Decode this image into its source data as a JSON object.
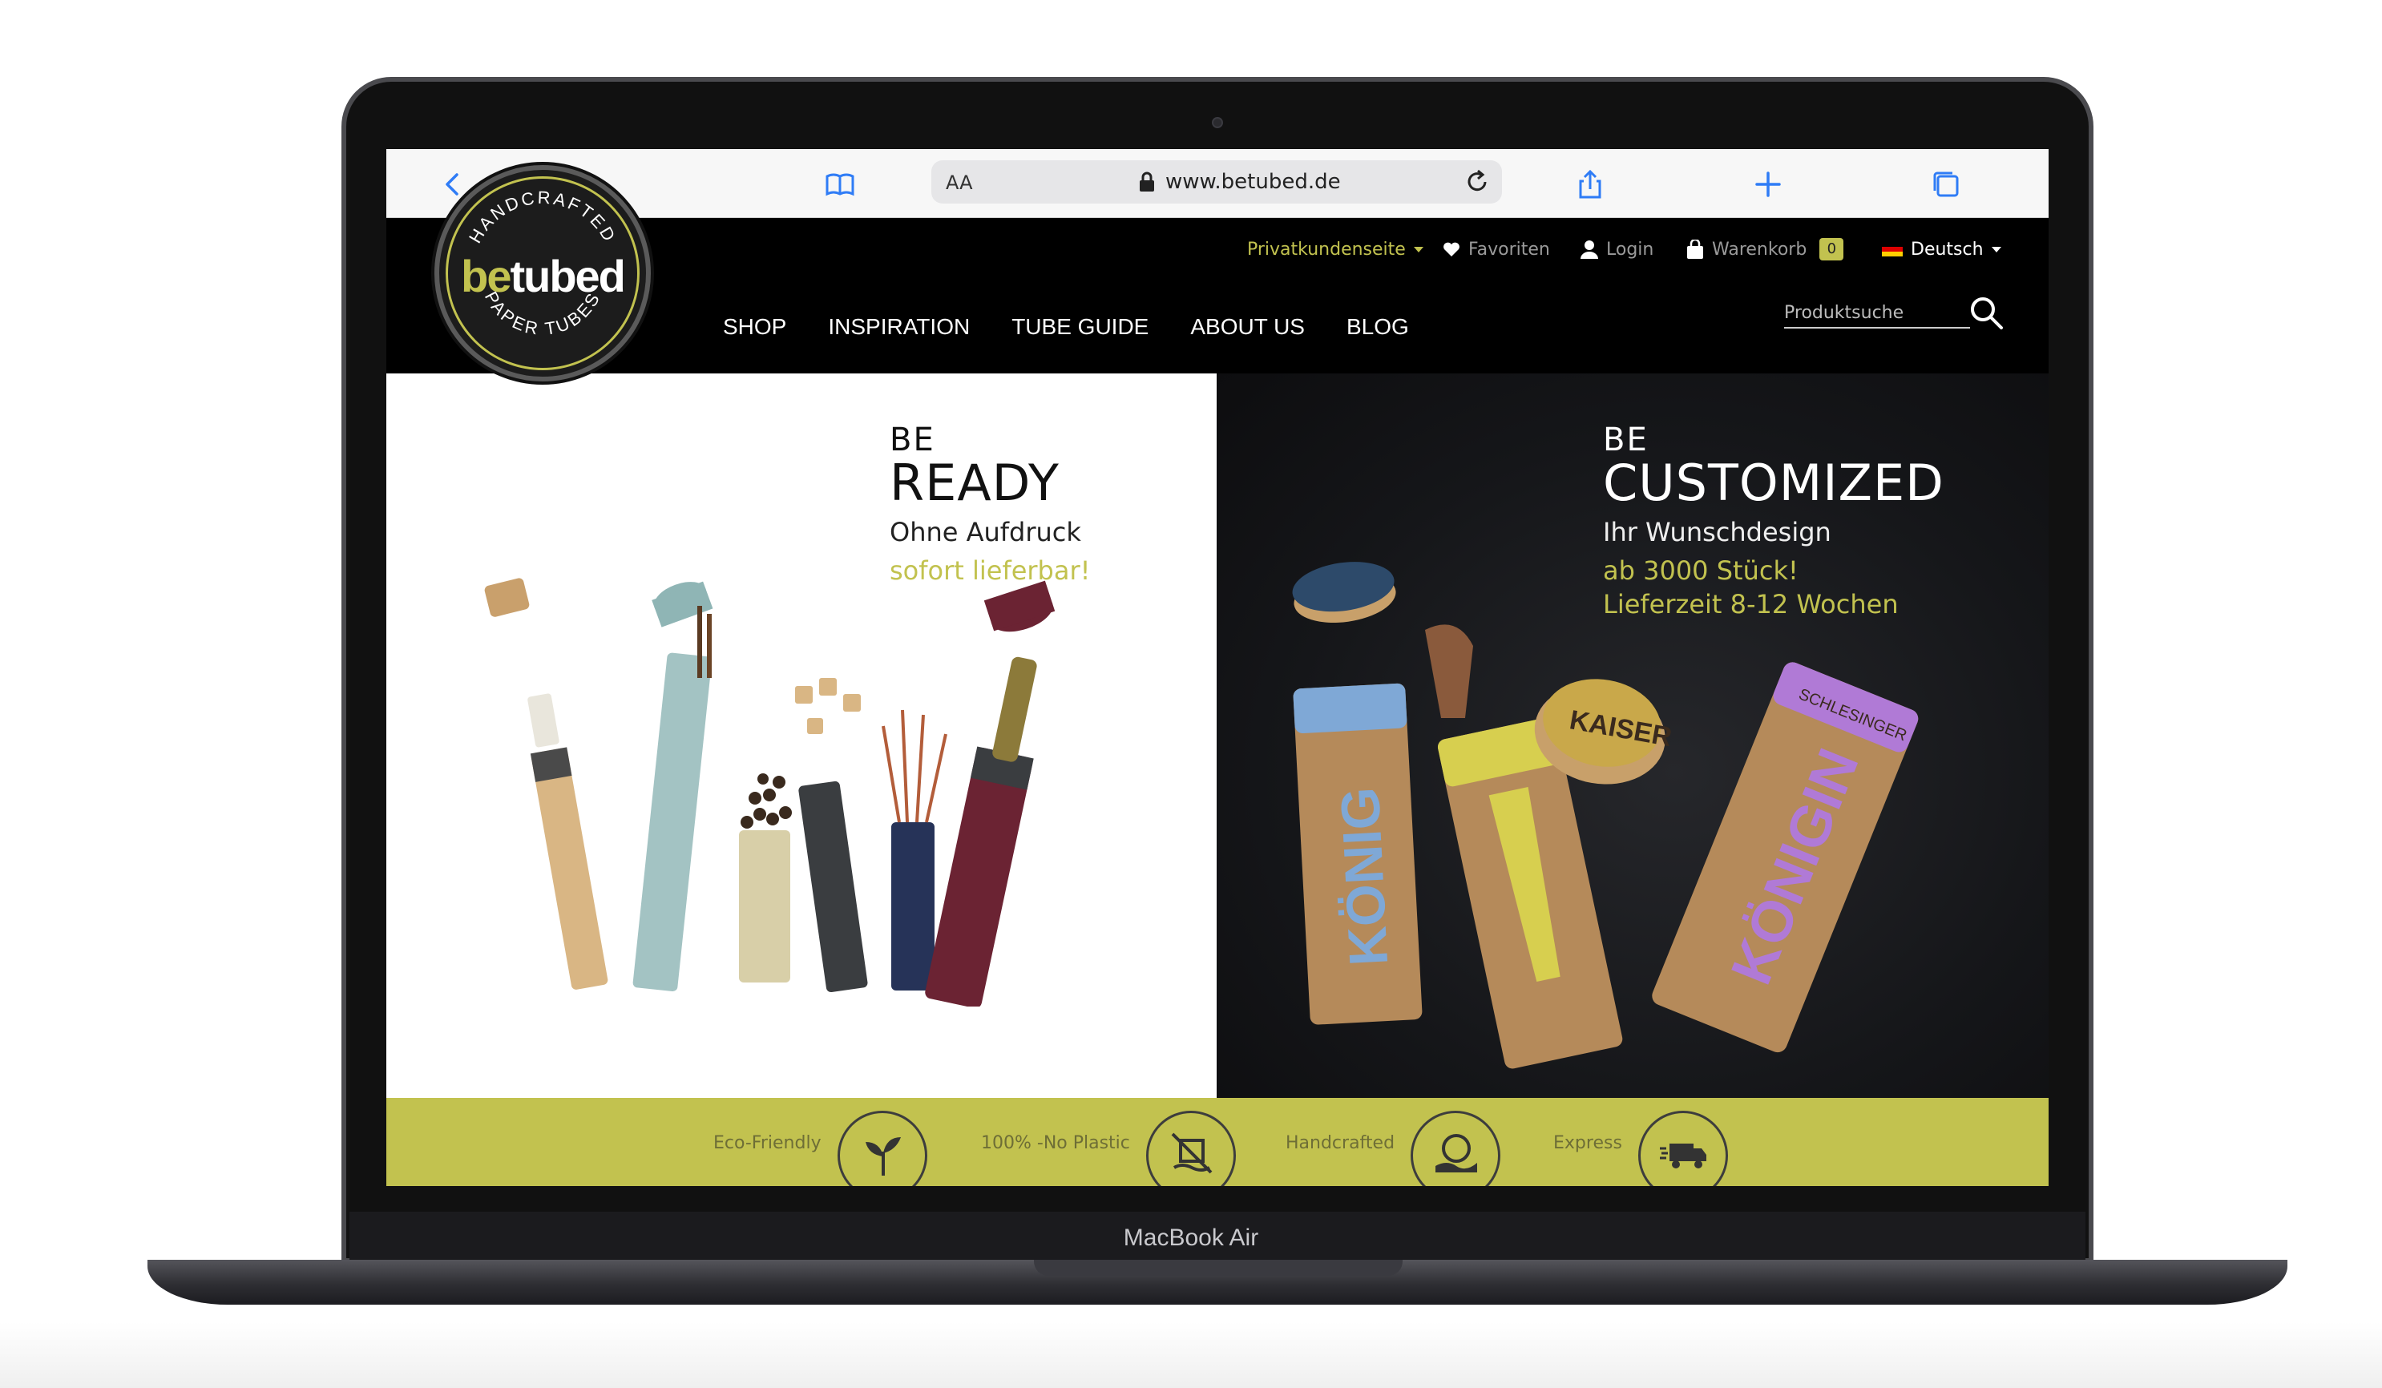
{
  "device": {
    "label": "MacBook Air"
  },
  "browser": {
    "text_size_label": "AA",
    "url": "www.betubed.de"
  },
  "util_bar": {
    "customer_page": "Privatkundenseite",
    "favorites": "Favoriten",
    "login": "Login",
    "cart": "Warenkorb",
    "cart_count": "0",
    "language": "Deutsch"
  },
  "logo": {
    "top_arc": "HANDCRAFTED",
    "word_accent": "be",
    "word_rest": "tubed",
    "bottom_arc": "PAPER TUBES"
  },
  "nav": {
    "items": [
      "SHOP",
      "INSPIRATION",
      "TUBE GUIDE",
      "ABOUT US",
      "BLOG"
    ]
  },
  "search": {
    "placeholder": "Produktsuche"
  },
  "hero_left": {
    "line1": "BE",
    "line2": "READY",
    "line3": "Ohne Aufdruck",
    "line4": "sofort lieferbar!"
  },
  "hero_right": {
    "line1": "BE",
    "line2": "CUSTOMIZED",
    "line3": "Ihr Wunschdesign",
    "line4": "ab 3000 Stück!",
    "line5": "Lieferzeit 8-12 Wochen",
    "tube_labels": [
      "KÖNIG",
      "KÖNIGIN",
      "KAISER",
      "SCHLESINGER"
    ]
  },
  "features": [
    {
      "label": "Eco-Friendly",
      "icon": "plant-icon"
    },
    {
      "label": "100% -No Plastic",
      "icon": "no-plastic-icon"
    },
    {
      "label": "Handcrafted",
      "icon": "handcrafted-icon"
    },
    {
      "label": "Express",
      "icon": "truck-icon"
    }
  ],
  "colors": {
    "accent": "#c2c24f",
    "header_bg": "#000000",
    "toolbar_blue": "#2f7cf6"
  }
}
